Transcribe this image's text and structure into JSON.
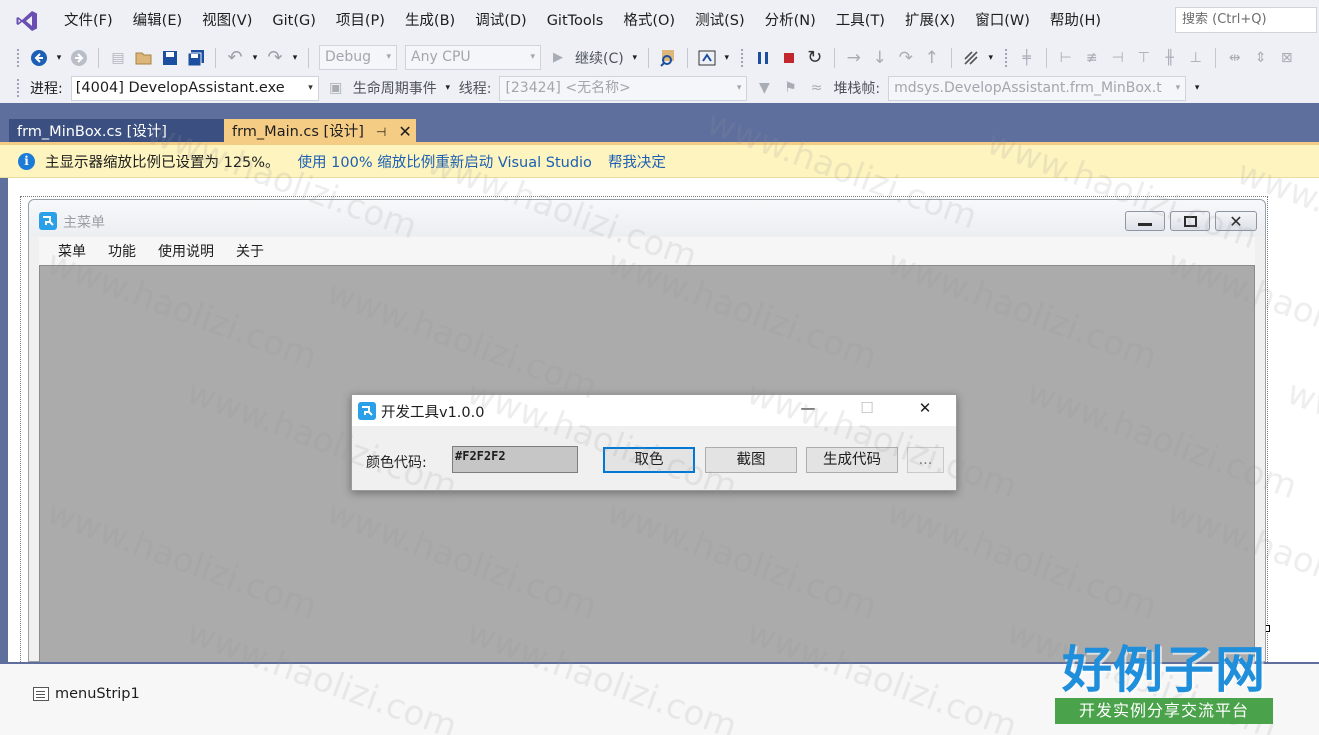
{
  "menubar": {
    "items": [
      "文件(F)",
      "编辑(E)",
      "视图(V)",
      "Git(G)",
      "项目(P)",
      "生成(B)",
      "调试(D)",
      "GitTools",
      "格式(O)",
      "测试(S)",
      "分析(N)",
      "工具(T)",
      "扩展(X)",
      "窗口(W)",
      "帮助(H)"
    ],
    "search_placeholder": "搜索 (Ctrl+Q)"
  },
  "toolbar": {
    "config": "Debug",
    "platform": "Any CPU",
    "continue": "继续(C)",
    "process_label": "进程:",
    "process_value": "[4004] DevelopAssistant.exe",
    "lifecycle": "生命周期事件",
    "thread_label": "线程:",
    "thread_value": "[23424] <无名称>",
    "stack_label": "堆栈帧:",
    "stack_value": "mdsys.DevelopAssistant.frm_MinBox.t"
  },
  "tabs": {
    "inactive": "frm_MinBox.cs [设计]",
    "active": "frm_Main.cs [设计]"
  },
  "infobar": {
    "message": "主显示器缩放比例已设置为 125%。",
    "link_restart": "使用 100% 缩放比例重新启动 Visual Studio",
    "link_help": "帮我决定"
  },
  "main_form": {
    "title": "主菜单",
    "menu": [
      "菜单",
      "功能",
      "使用说明",
      "关于"
    ]
  },
  "child_form": {
    "title": "开发工具v1.0.0",
    "color_label": "颜色代码:",
    "color_value": "#F2F2F2",
    "btn_pick": "取色",
    "btn_screenshot": "截图",
    "btn_generate": "生成代码",
    "btn_more": "..."
  },
  "tray": {
    "component": "menuStrip1"
  },
  "watermark": {
    "text": "www.haolizi.com",
    "logo_main": "好例子网",
    "logo_sub": "开发实例分享交流平台"
  },
  "colors": {
    "tab_active": "#f5cc84",
    "tab_inactive": "#3b4f81",
    "tabstrip": "#5e6f9e",
    "infobar": "#fdf4bf",
    "link": "#1a5fb4",
    "mdi_background": "#ababab"
  }
}
